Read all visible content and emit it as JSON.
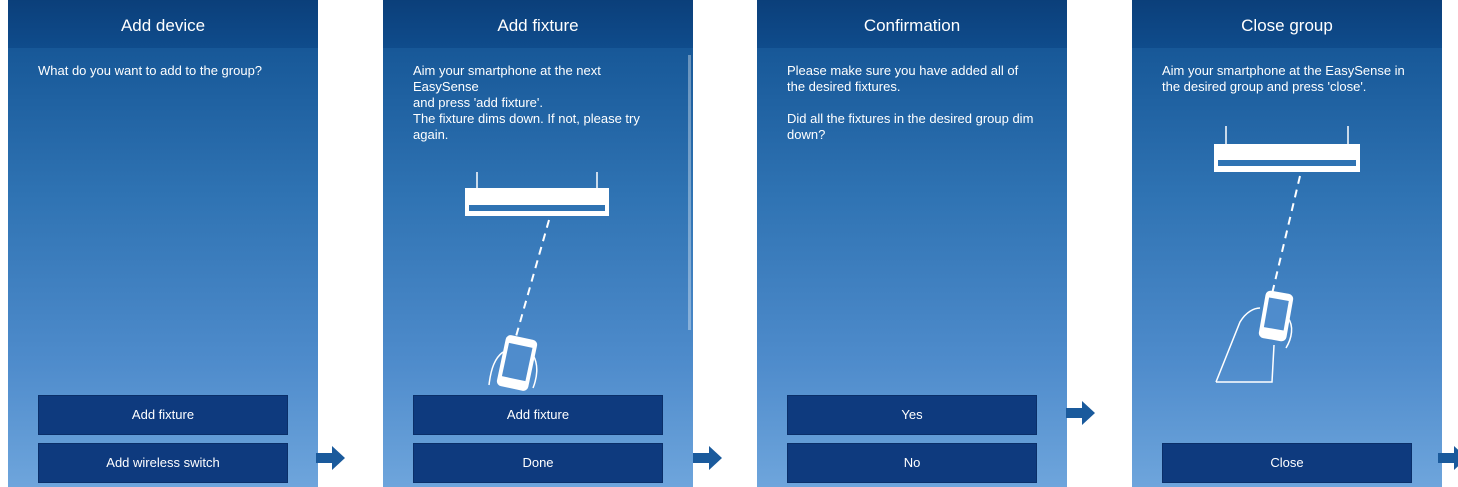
{
  "screens": [
    {
      "title": "Add device",
      "text": "What do you want to add to the group?",
      "buttons": [
        "Add fixture",
        "Add wireless switch"
      ]
    },
    {
      "title": "Add fixture",
      "text": "Aim your smartphone at the next EasySense\nand press 'add fixture'.\nThe fixture dims down. If not, please try again.",
      "buttons": [
        "Add fixture",
        "Done"
      ]
    },
    {
      "title": "Confirmation",
      "text": "Please make sure you have added all of the desired fixtures.\n\nDid all the fixtures in the desired group dim down?",
      "buttons": [
        "Yes",
        "No"
      ]
    },
    {
      "title": "Close group",
      "text": "Aim your smartphone at the EasySense in the desired group and press 'close'.",
      "buttons": [
        "Close"
      ]
    }
  ],
  "colors": {
    "header": "#0b3f7a",
    "button": "#0e3a7e",
    "arrow": "#1a5a9c"
  },
  "icons": {
    "flow_arrow": "arrow-right-icon",
    "fixture": "light-fixture-icon",
    "phone": "smartphone-in-hand-icon"
  }
}
